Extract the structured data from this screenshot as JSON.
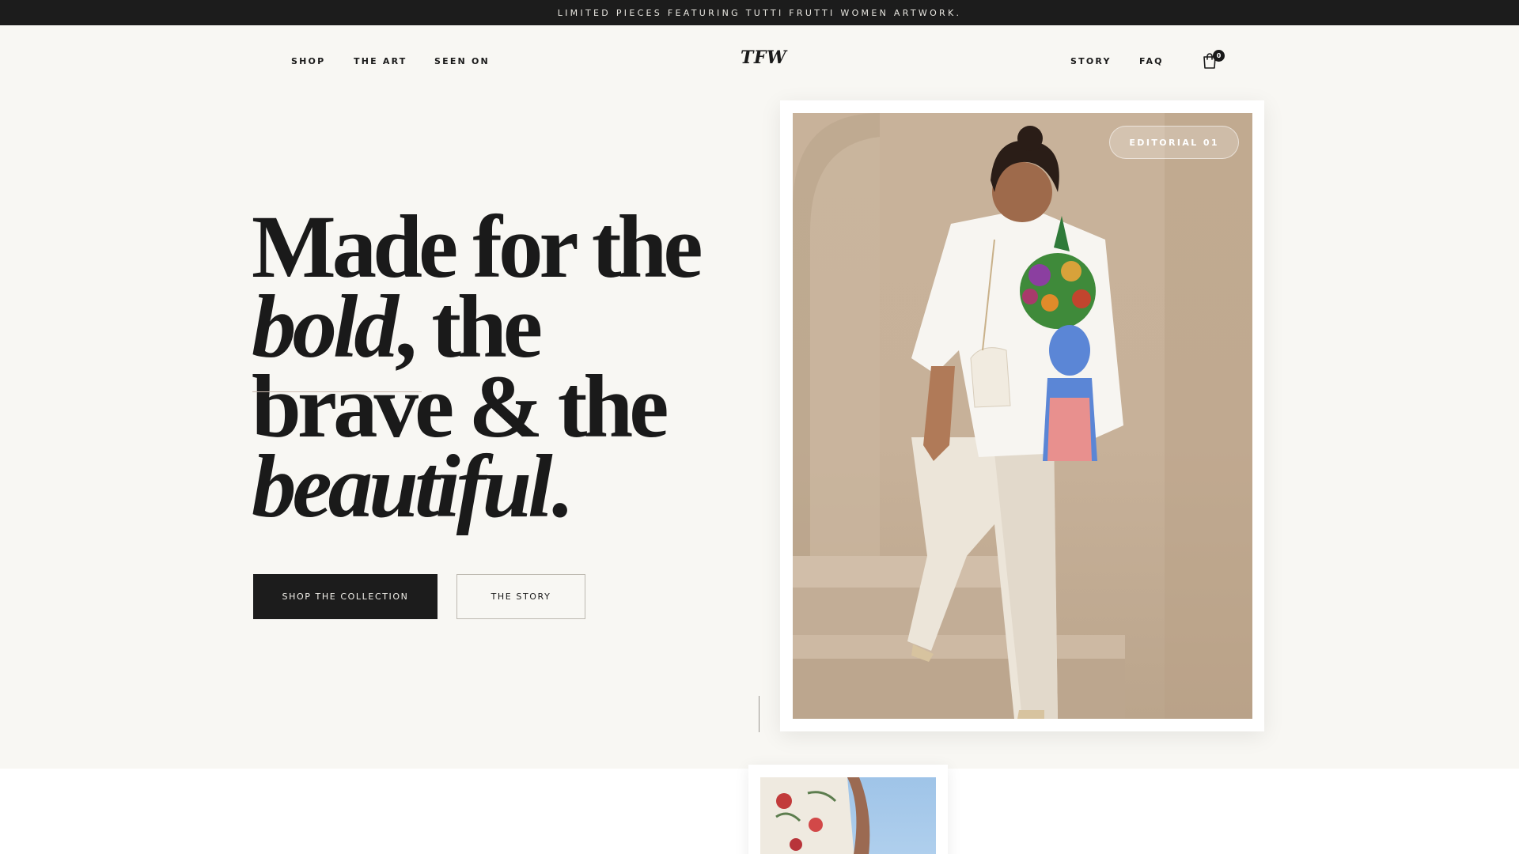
{
  "announcement": "LIMITED PIECES FEATURING TUTTI FRUTTI WOMEN ARTWORK.",
  "nav": {
    "left": [
      "SHOP",
      "THE ART",
      "SEEN ON"
    ],
    "right": [
      "STORY",
      "FAQ"
    ],
    "logo": "TFW",
    "cart_count": "0",
    "cart_icon": "shopping-bag-icon"
  },
  "hero": {
    "headline": {
      "line1": "Made for the",
      "line2_em": "bold",
      "line2_rest": ", the",
      "line3": "brave & the",
      "line4_em": "beautiful",
      "line4_rest": "."
    },
    "primary_cta": "SHOP THE COLLECTION",
    "secondary_cta": "THE STORY",
    "badge": "EDITORIAL 01"
  },
  "colors": {
    "background": "#f8f7f3",
    "dark": "#1c1c1c",
    "image_backdrop": "#c8b29a"
  }
}
